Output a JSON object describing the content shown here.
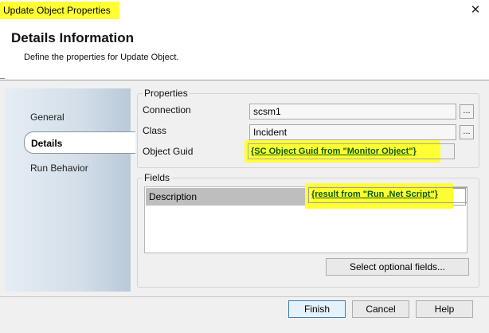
{
  "window": {
    "title": "Update Object Properties",
    "close_glyph": "✕"
  },
  "header": {
    "title": "Details Information",
    "subtitle": "Define the properties for Update Object."
  },
  "nav": {
    "items": [
      {
        "label": "General",
        "selected": false
      },
      {
        "label": "Details",
        "selected": true
      },
      {
        "label": "Run Behavior",
        "selected": false
      }
    ]
  },
  "properties": {
    "legend": "Properties",
    "connection_label": "Connection",
    "connection_value": "scsm1",
    "class_label": "Class",
    "class_value": "Incident",
    "guid_label": "Object Guid",
    "guid_value": "{SC Object Guid from \"Monitor Object\"}",
    "browse_label": "..."
  },
  "fields": {
    "legend": "Fields",
    "rows": [
      {
        "name": "Description",
        "value": "{result from \"Run .Net Script\"}"
      }
    ],
    "select_optional_label": "Select optional fields..."
  },
  "footer": {
    "finish_label": "Finish",
    "cancel_label": "Cancel",
    "help_label": "Help"
  },
  "colors": {
    "highlight": "#ffff33",
    "link_green": "#0a5a0a"
  }
}
